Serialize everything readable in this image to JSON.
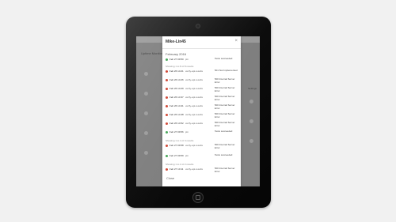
{
  "modal": {
    "title": "Mike-Lin45",
    "close_symbol": "×",
    "month": "February 2016",
    "rows": [
      {
        "date": "Feb 27 09:50",
        "action": "pin",
        "status": "Tests succeeded",
        "color": "#4aa85c"
      },
      {
        "date": "Feb 26 14:21",
        "action": "verify-api-results",
        "status": "501 Not Implemented",
        "color": "#d14b3a"
      },
      {
        "date": "Feb 26 14:26",
        "action": "verify-api-results",
        "status": "500 Internal Server Error",
        "color": "#d14b3a"
      },
      {
        "date": "Feb 26 14:29",
        "action": "verify-api-results",
        "status": "500 Internal Server Error",
        "color": "#d14b3a"
      },
      {
        "date": "Feb 26 14:37",
        "action": "verify-api-results",
        "status": "500 Internal Server Error",
        "color": "#d14b3a"
      },
      {
        "date": "Feb 26 14:41",
        "action": "verify-api-results",
        "status": "500 Internal Server Error",
        "color": "#d14b3a"
      },
      {
        "date": "Feb 26 14:48",
        "action": "verify-api-results",
        "status": "500 Internal Server Error",
        "color": "#d14b3a"
      },
      {
        "date": "Feb 26 14:52",
        "action": "verify-api-results",
        "status": "500 Internal Server Error",
        "color": "#d14b3a"
      },
      {
        "date": "Feb 27 09:56",
        "action": "pin",
        "status": "Tests succeeded",
        "color": "#4aa85c"
      },
      {
        "date": "Feb 27 09:58",
        "action": "verify-api-results",
        "status": "500 Internal Server Error",
        "color": "#d14b3a"
      },
      {
        "date": "Feb 27 09:59",
        "action": "pin",
        "status": "Tests succeeded",
        "color": "#4aa85c"
      },
      {
        "date": "Feb 27 10:11",
        "action": "verify-api-results",
        "status": "500 Internal Server Error",
        "color": "#d14b3a"
      }
    ],
    "notes": [
      "Showing 1 to 8 of 8 results",
      "Showing 1 to 4 of 4 results",
      "Showing 1 to 2 of 2 results"
    ],
    "close_label": "Close"
  },
  "background": {
    "title": "Uptime Monitor",
    "right_label": "Settings"
  }
}
